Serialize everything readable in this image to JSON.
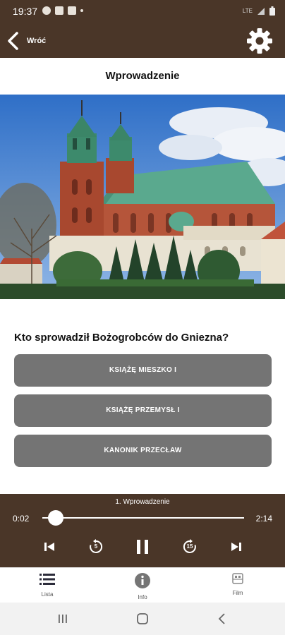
{
  "status_bar": {
    "time": "19:37",
    "network": "LTE"
  },
  "app_bar": {
    "back_label": "Wróć"
  },
  "page": {
    "title": "Wprowadzenie"
  },
  "quiz": {
    "question": "Kto sprowadził Bożogrobców do Gniezna?",
    "answers": [
      {
        "label": "KSIĄŻĘ MIESZKO I"
      },
      {
        "label": "KSIĄŻĘ PRZEMYSŁ I"
      },
      {
        "label": "KANONIK PRZECŁAW"
      }
    ]
  },
  "player": {
    "track_title": "1. Wprowadzenie",
    "current_time": "0:02",
    "total_time": "2:14",
    "progress": 0.015,
    "rewind_label": "5",
    "forward_label": "15"
  },
  "bottom_nav": {
    "items": [
      {
        "label": "Lista",
        "icon": "list-icon"
      },
      {
        "label": "Info",
        "icon": "info-icon"
      },
      {
        "label": "Film",
        "icon": "film-icon"
      }
    ]
  },
  "colors": {
    "brown": "#4a3628",
    "button_gray": "#747474"
  }
}
